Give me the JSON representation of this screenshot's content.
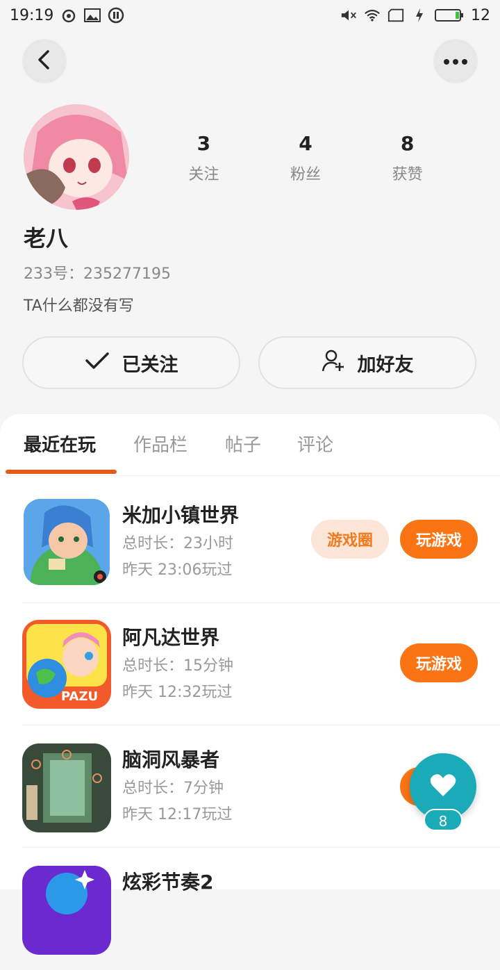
{
  "status_bar": {
    "time": "19:19",
    "battery": "12"
  },
  "profile": {
    "stats": [
      {
        "value": "3",
        "label": "关注"
      },
      {
        "value": "4",
        "label": "粉丝"
      },
      {
        "value": "8",
        "label": "获赞"
      }
    ],
    "name": "老八",
    "uid_line": "233号：235277195",
    "bio": "TA什么都没有写"
  },
  "actions": {
    "follow_label": "已关注",
    "add_friend_label": "加好友"
  },
  "tabs": [
    "最近在玩",
    "作品栏",
    "帖子",
    "评论"
  ],
  "games": [
    {
      "name": "米加小镇世界",
      "duration": "总时长：23小时",
      "last_played": "昨天 23:06玩过",
      "circle_label": "游戏圈",
      "play_label": "玩游戏"
    },
    {
      "name": "阿凡达世界",
      "duration": "总时长：15分钟",
      "last_played": "昨天 12:32玩过",
      "play_label": "玩游戏",
      "icon_text": "PAZU"
    },
    {
      "name": "脑洞风暴者",
      "duration": "总时长：7分钟",
      "last_played": "昨天 12:17玩过"
    },
    {
      "name": "炫彩节奏2"
    }
  ],
  "like_fab": {
    "count": "8"
  },
  "colors": {
    "accent": "#fa7414",
    "tab_underline": "#e55a14",
    "fab": "#1aaab8"
  }
}
